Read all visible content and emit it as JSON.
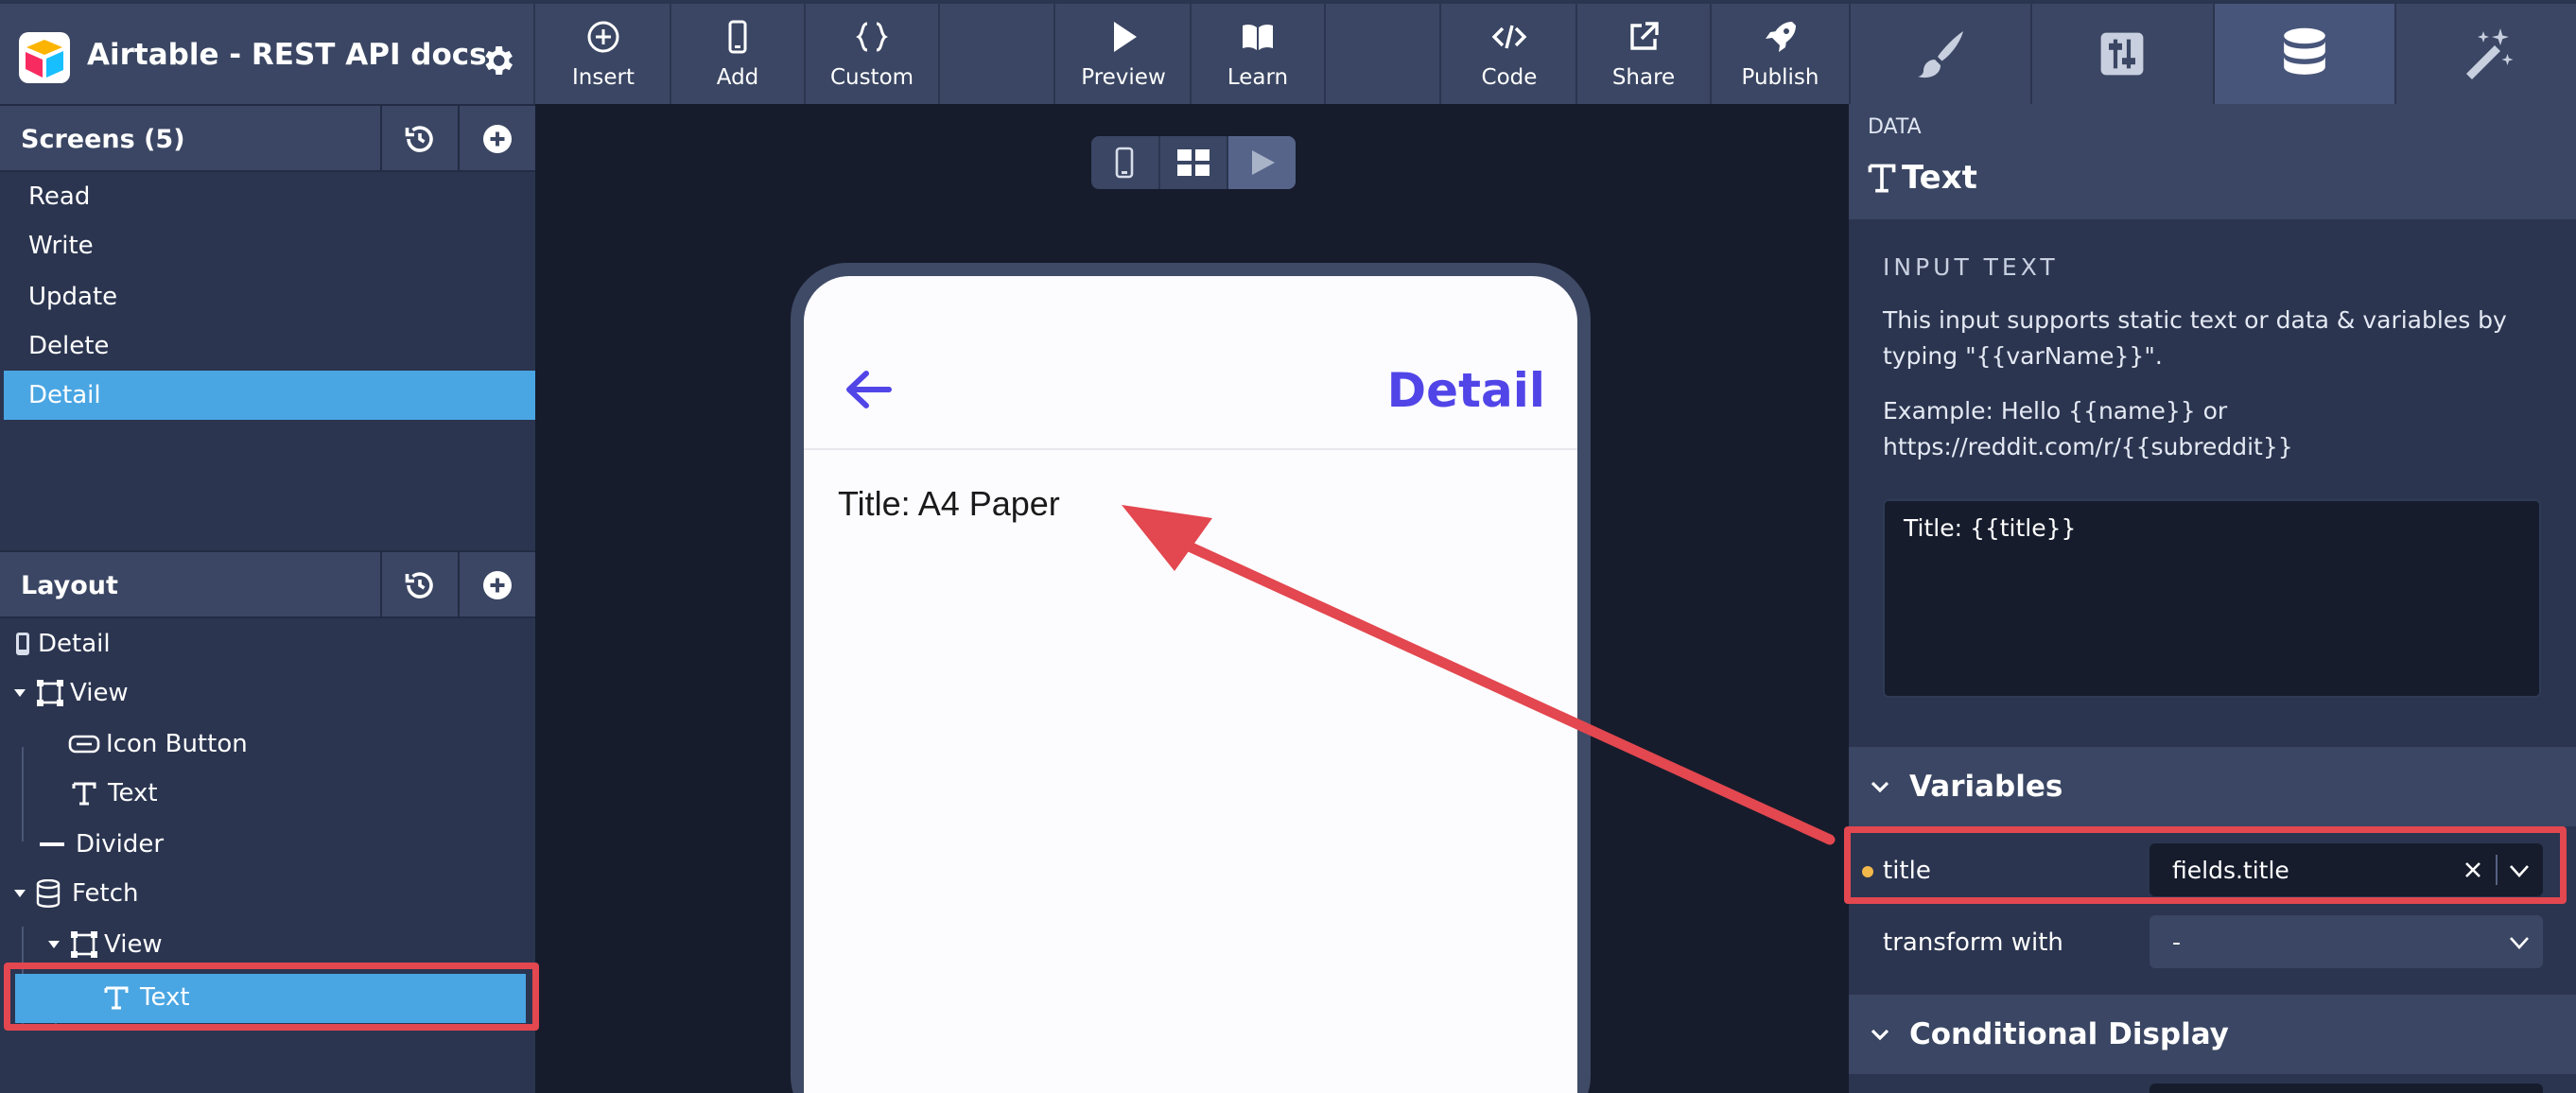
{
  "app": {
    "title": "Airtable - REST API docs"
  },
  "toolbar": {
    "insert": "Insert",
    "add": "Add",
    "custom": "Custom",
    "preview": "Preview",
    "learn": "Learn",
    "code": "Code",
    "share": "Share",
    "publish": "Publish"
  },
  "panel_tabs": [
    {
      "icon": "paintbrush-icon"
    },
    {
      "icon": "sliders-icon"
    },
    {
      "icon": "database-icon",
      "active": true
    },
    {
      "icon": "magic-wand-icon"
    }
  ],
  "screens": {
    "title": "Screens (5)",
    "items": [
      {
        "label": "Read"
      },
      {
        "label": "Write"
      },
      {
        "label": "Update"
      },
      {
        "label": "Delete"
      },
      {
        "label": "Detail",
        "selected": true
      }
    ]
  },
  "layout": {
    "title": "Layout",
    "tree": [
      {
        "label": "Detail",
        "icon": "phone-icon"
      },
      {
        "label": "View",
        "icon": "view-frame-icon",
        "expanded": true
      },
      {
        "label": "Icon Button",
        "icon": "icon-button-icon"
      },
      {
        "label": "Text",
        "icon": "text-icon"
      },
      {
        "label": "Divider",
        "icon": "divider-icon"
      },
      {
        "label": "Fetch",
        "icon": "database-icon",
        "expanded": true
      },
      {
        "label": "View",
        "icon": "view-frame-icon",
        "expanded": true
      },
      {
        "label": "Text",
        "icon": "text-icon",
        "selected": true
      }
    ]
  },
  "preview": {
    "header_title": "Detail",
    "body_text": "Title: A4 Paper"
  },
  "right_panel": {
    "kicker": "DATA",
    "title": "Text",
    "input_section_title": "INPUT TEXT",
    "help_line1": "This input supports static text or data & variables by typing \"{{varName}}\".",
    "help_line2": "Example: Hello {{name}} or https://reddit.com/r/{{subreddit}}",
    "input_value": "Title: {{title}}",
    "variables_title": "Variables",
    "var_name": "title",
    "var_value": "fields.title",
    "transform_label": "transform with",
    "transform_value": "-",
    "conditional_title": "Conditional Display"
  },
  "colors": {
    "accent_blue": "#4aa6e3",
    "annotation_red": "#e3474f",
    "detail_purple": "#5145e8",
    "variable_dot": "#f2b84b"
  }
}
